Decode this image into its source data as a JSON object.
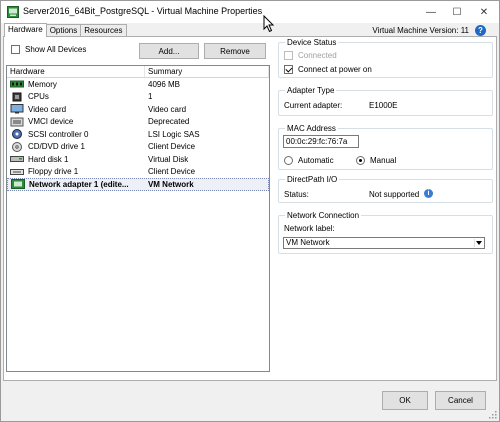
{
  "window": {
    "title": "Server2016_64Bit_PostgreSQL - Virtual Machine Properties",
    "minimize_glyph": "—",
    "maximize_glyph": "☐",
    "close_glyph": "✕"
  },
  "tabs": [
    {
      "label": "Hardware",
      "active": true
    },
    {
      "label": "Options",
      "active": false
    },
    {
      "label": "Resources",
      "active": false
    }
  ],
  "version_text": "Virtual Machine Version: 11",
  "help_glyph": "?",
  "show_all_devices": {
    "label": "Show All Devices",
    "checked": false
  },
  "buttons": {
    "add": "Add...",
    "remove": "Remove",
    "ok": "OK",
    "cancel": "Cancel"
  },
  "hardware_table": {
    "columns": [
      "Hardware",
      "Summary"
    ],
    "rows": [
      {
        "icon": "memory-icon",
        "name": "Memory",
        "summary": "4096 MB"
      },
      {
        "icon": "cpu-icon",
        "name": "CPUs",
        "summary": "1"
      },
      {
        "icon": "video-card-icon",
        "name": "Video card",
        "summary": "Video card"
      },
      {
        "icon": "vmci-device-icon",
        "name": "VMCI device",
        "summary": "Deprecated"
      },
      {
        "icon": "scsi-controller-icon",
        "name": "SCSI controller 0",
        "summary": "LSI Logic SAS"
      },
      {
        "icon": "cd-dvd-drive-icon",
        "name": "CD/DVD drive 1",
        "summary": "Client Device"
      },
      {
        "icon": "hard-disk-icon",
        "name": "Hard disk 1",
        "summary": "Virtual Disk"
      },
      {
        "icon": "floppy-drive-icon",
        "name": "Floppy drive 1",
        "summary": "Client Device"
      },
      {
        "icon": "network-adapter-icon",
        "name": "Network adapter 1 (edite...",
        "summary": "VM Network",
        "selected": true
      }
    ]
  },
  "device_status": {
    "title": "Device Status",
    "connected": {
      "label": "Connected",
      "checked": false,
      "disabled": true
    },
    "connect_at_power_on": {
      "label": "Connect at power on",
      "checked": true
    }
  },
  "adapter_type": {
    "title": "Adapter Type",
    "label": "Current adapter:",
    "value": "E1000E"
  },
  "mac_address": {
    "title": "MAC Address",
    "value": "00:0c:29:fc:76:7a",
    "automatic_label": "Automatic",
    "manual_label": "Manual",
    "selected": "Manual"
  },
  "directpath": {
    "title": "DirectPath I/O",
    "status_label": "Status:",
    "status_value": "Not supported",
    "info_glyph": "i"
  },
  "network_connection": {
    "title": "Network Connection",
    "label": "Network label:",
    "value": "VM Network"
  },
  "colors": {
    "accent_blue": "#1e68c8",
    "selection_bg": "#eef0f8",
    "icon_green": "#2e8b3a"
  }
}
